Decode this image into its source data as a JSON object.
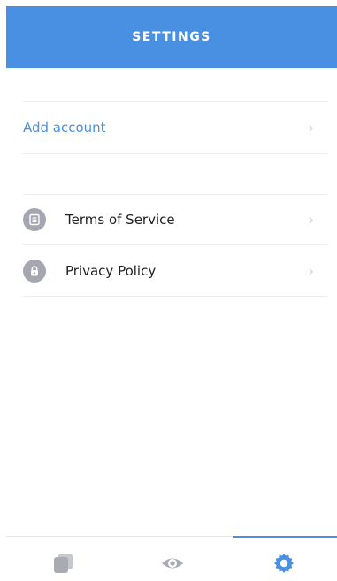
{
  "header": {
    "title": "SETTINGS"
  },
  "account": {
    "add_account_label": "Add account"
  },
  "legal": {
    "items": [
      {
        "label": "Terms of Service",
        "icon": "document-icon"
      },
      {
        "label": "Privacy Policy",
        "icon": "lock-icon"
      }
    ]
  },
  "nav": {
    "items": [
      {
        "name": "pages-icon"
      },
      {
        "name": "eye-icon"
      },
      {
        "name": "gear-icon"
      }
    ],
    "active_index": 2
  },
  "colors": {
    "accent": "#4a90e2",
    "icon_gray": "#a4a7b0",
    "chevron": "#cfcfcf",
    "divider": "#ececec"
  }
}
